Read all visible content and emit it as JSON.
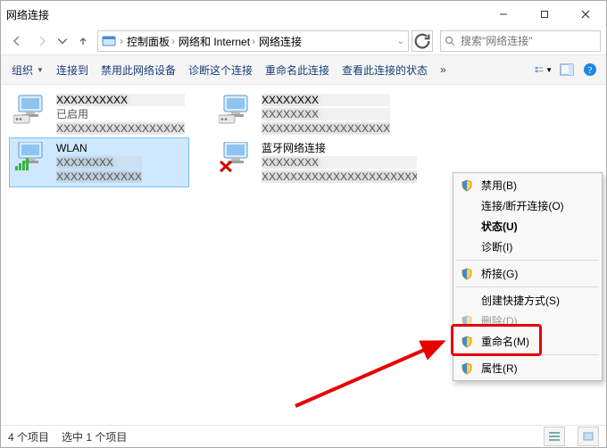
{
  "window": {
    "title": "网络连接"
  },
  "titlebar_buttons": {
    "min": "minimize",
    "max": "maximize",
    "close": "close"
  },
  "nav": {
    "breadcrumb": [
      "控制面板",
      "网络和 Internet",
      "网络连接"
    ],
    "search_placeholder": "搜索\"网络连接\""
  },
  "toolbar": {
    "organize": "组织",
    "connect_to": "连接到",
    "disable_device": "禁用此网络设备",
    "diagnose": "诊断这个连接",
    "rename": "重命名此连接",
    "view_status": "查看此连接的状态",
    "more": "»"
  },
  "items": [
    {
      "name_blurred": true,
      "status": "已启用",
      "tertiary_blurred": true
    },
    {
      "name_blurred": true,
      "status_blurred": true,
      "tertiary_blurred": true
    },
    {
      "name": "WLAN",
      "selected": true,
      "status_blurred": true,
      "tertiary_blurred": true,
      "signal": true
    },
    {
      "name": "蓝牙网络连接",
      "status_blurred": true,
      "tertiary_blurred": true,
      "red_x": true
    }
  ],
  "context_menu": {
    "disable": "禁用(B)",
    "connect_disconnect": "连接/断开连接(O)",
    "status": "状态(U)",
    "diagnose": "诊断(I)",
    "bridge": "桥接(G)",
    "create_shortcut": "创建快捷方式(S)",
    "delete": "删除(D)",
    "rename": "重命名(M)",
    "properties": "属性(R)"
  },
  "statusbar": {
    "count": "4 个项目",
    "selected": "选中 1 个项目"
  }
}
